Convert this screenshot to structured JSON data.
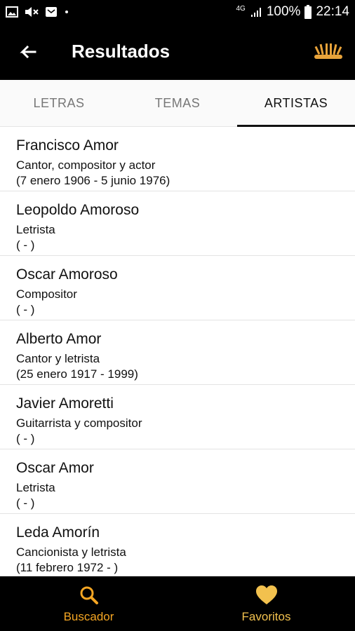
{
  "status_bar": {
    "battery": "100%",
    "time": "22:14",
    "network": "4G"
  },
  "app_bar": {
    "title": "Resultados"
  },
  "tabs": [
    {
      "label": "LETRAS",
      "active": false
    },
    {
      "label": "TEMAS",
      "active": false
    },
    {
      "label": "ARTISTAS",
      "active": true
    }
  ],
  "artists": [
    {
      "name": "Francisco Amor",
      "role": "Cantor, compositor y actor",
      "dates": "(7 enero 1906 - 5 junio 1976)"
    },
    {
      "name": "Leopoldo Amoroso",
      "role": "Letrista",
      "dates": "( - )"
    },
    {
      "name": "Oscar Amoroso",
      "role": "Compositor",
      "dates": "( - )"
    },
    {
      "name": "Alberto Amor",
      "role": "Cantor y letrista",
      "dates": "(25 enero 1917 - 1999)"
    },
    {
      "name": "Javier Amoretti",
      "role": "Guitarrista y compositor",
      "dates": "( - )"
    },
    {
      "name": "Oscar Amor",
      "role": "Letrista",
      "dates": "( - )"
    },
    {
      "name": "Leda Amorín",
      "role": "Cancionista y letrista",
      "dates": "(11 febrero 1972 - )"
    }
  ],
  "bottom_nav": {
    "search_label": "Buscador",
    "favorites_label": "Favoritos"
  },
  "colors": {
    "accent": "#f5a623",
    "favorite": "#f2c14e",
    "bar_background": "#000000"
  }
}
